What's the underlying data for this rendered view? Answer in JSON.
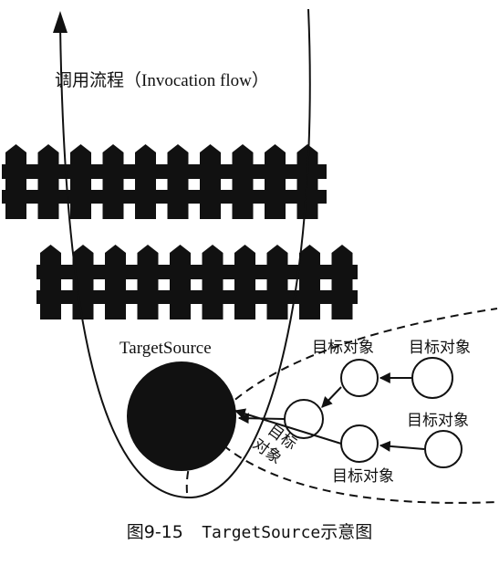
{
  "diagram": {
    "flow_label": "调用流程（Invocation flow）",
    "pool_label": "TargetSource",
    "target_object_label": "目标对象",
    "target_object_label_line1": "目标",
    "target_object_label_line2": "对象"
  },
  "caption": {
    "figure_number": "图9-15",
    "code_name": "TargetSource",
    "suffix": "示意图"
  },
  "colors": {
    "ink": "#111111",
    "background": "#ffffff"
  }
}
